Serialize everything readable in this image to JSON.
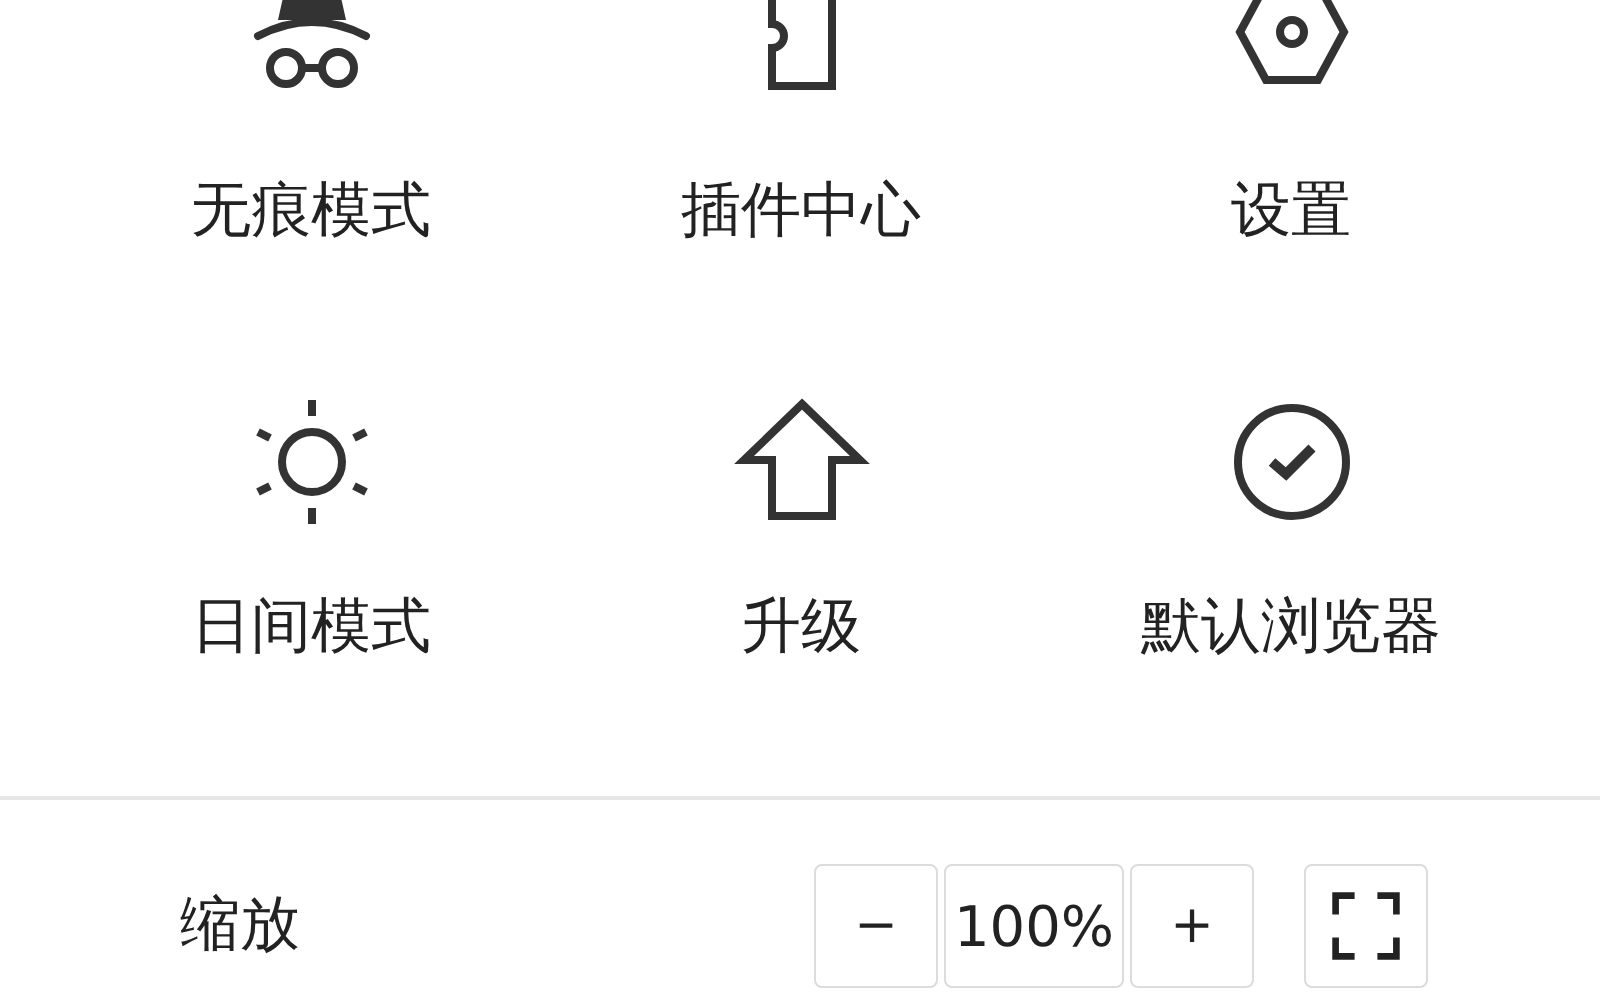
{
  "menu_items": [
    {
      "label": "无痕模式",
      "kind": "incognito"
    },
    {
      "label": "插件中心",
      "kind": "puzzle"
    },
    {
      "label": "设置",
      "kind": "settings"
    },
    {
      "label": "日间模式",
      "kind": "sun"
    },
    {
      "label": "升级",
      "kind": "arrow-up"
    },
    {
      "label": "默认浏览器",
      "kind": "check-circle"
    }
  ],
  "zoom": {
    "label": "缩放",
    "decrease": "−",
    "value": "100%",
    "increase": "+"
  }
}
